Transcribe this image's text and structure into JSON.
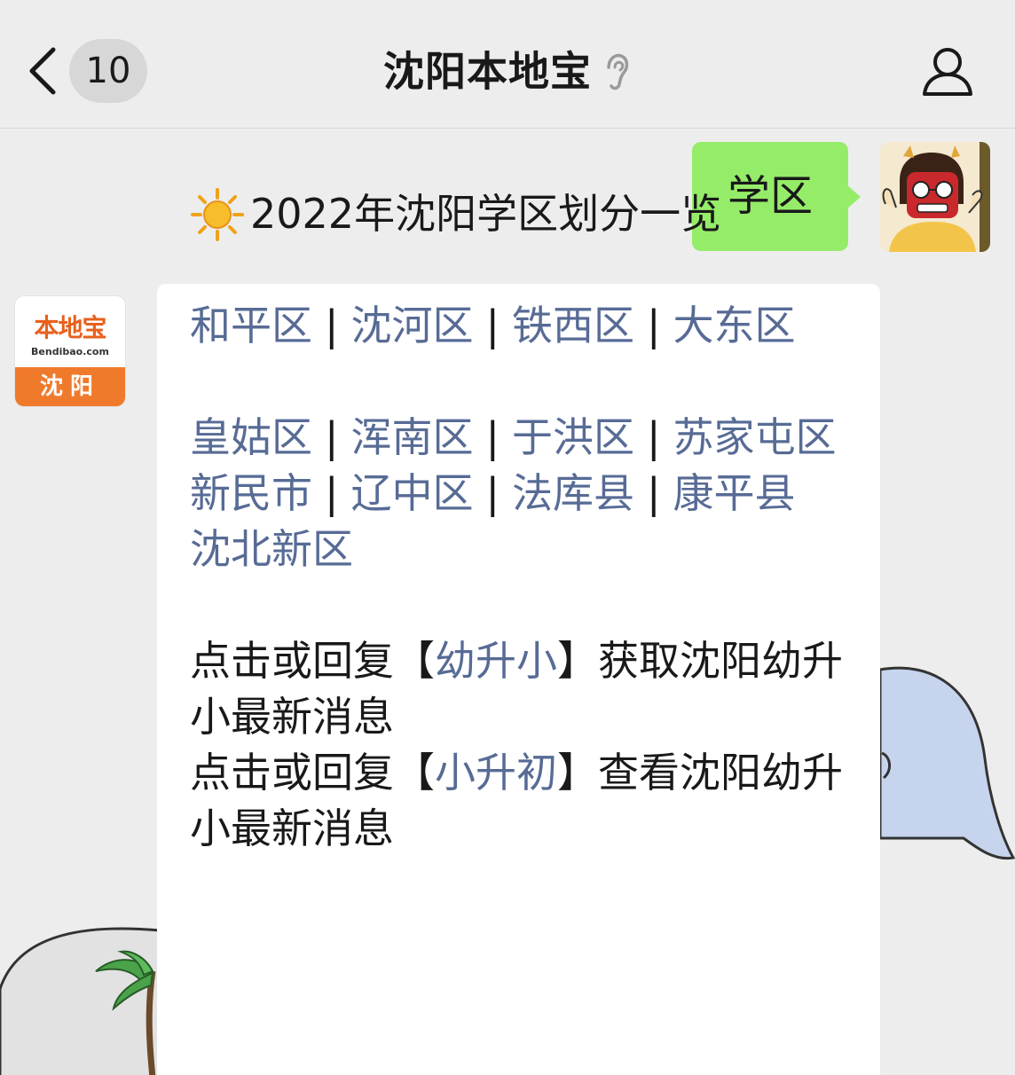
{
  "nav": {
    "unread_count": "10",
    "title": "沈阳本地宝"
  },
  "outgoing": {
    "text": "学区"
  },
  "account_logo": {
    "name": "本地宝",
    "url_text": "Bendibao.com",
    "city": "沈阳",
    "brand_color": "#f07a2c"
  },
  "message": {
    "heading": "2022年沈阳学区划分一览",
    "districts": {
      "heping": "和平区",
      "shenhe": "沈河区",
      "tiexi": "铁西区",
      "dadong": "大东区",
      "huanggu": "皇姑区",
      "hunnan": "浑南区",
      "yuhong": "于洪区",
      "sujiatun": "苏家屯区",
      "xinmin": "新民市",
      "liaozhong": "辽中区",
      "faku": "法库县",
      "kangping": "康平县",
      "shenbei": "沈北新区"
    },
    "separator": "|",
    "line1_prefix": "点击或回复【",
    "line1_link": "幼升小",
    "line1_suffix": "】获取沈阳幼升小最新消息",
    "line2_prefix": "点击或回复【",
    "line2_link": "小升初",
    "line2_suffix": "】查看沈阳幼升小最新消息"
  },
  "colors": {
    "nav_bg": "#ededed",
    "outgoing_bubble": "#95ec69",
    "link": "#576b95"
  },
  "icons": [
    "back-arrow-icon",
    "ear-icon",
    "profile-icon",
    "sun-icon"
  ]
}
